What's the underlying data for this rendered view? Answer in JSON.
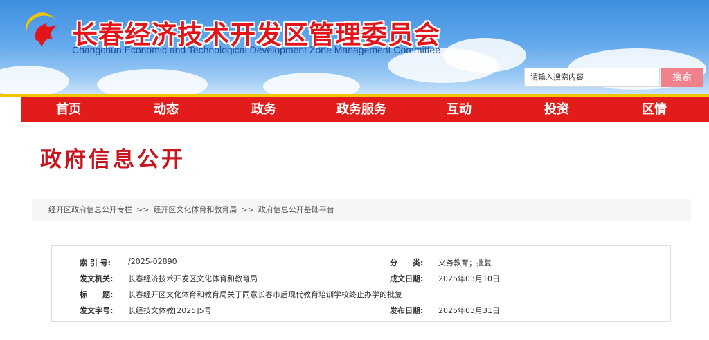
{
  "header": {
    "title": "长春经济技术开发区管理委员会",
    "subtitle": "Changchun Economic and Technological Development Zone Management Committee",
    "logo_icon": "red-phoenix-logo-icon",
    "search": {
      "placeholder": "请输入搜索内容",
      "button_label": "搜索"
    }
  },
  "nav": {
    "items": [
      {
        "label": "首页"
      },
      {
        "label": "动态"
      },
      {
        "label": "政务"
      },
      {
        "label": "政务服务"
      },
      {
        "label": "互动"
      },
      {
        "label": "投资"
      },
      {
        "label": "区情"
      }
    ]
  },
  "page": {
    "heading": "政府信息公开"
  },
  "breadcrumb": {
    "items": [
      "经开区政府信息公开专栏",
      "经开区文化体育和教育局",
      "政府信息公开基础平台"
    ],
    "separator": ">>"
  },
  "info": {
    "index_label": "索 引 号:",
    "index_value": "/2025-02890",
    "category_label": "分　　类:",
    "category_value": "义务教育；批复",
    "issuer_label": "发文机关:",
    "issuer_value": "长春经济技术开发区文化体育和教育局",
    "created_label": "成文日期:",
    "created_value": "2025年03月10日",
    "title_label": "标　　题:",
    "title_value": "长春经开区文化体育和教育局关于同意长春市后现代教育培训学校终止办学的批复",
    "doc_no_label": "发文字号:",
    "doc_no_value": "长经技文体教[2025]5号",
    "published_label": "发布日期:",
    "published_value": "2025年03月31日"
  },
  "colors": {
    "nav_red": "#e21b1b",
    "nav_top_stripe": "#f3c500",
    "title_red": "#e3141a",
    "heading_red": "#c9151e",
    "search_button": "#f0808a",
    "sky_blue": "#4a95e2"
  }
}
